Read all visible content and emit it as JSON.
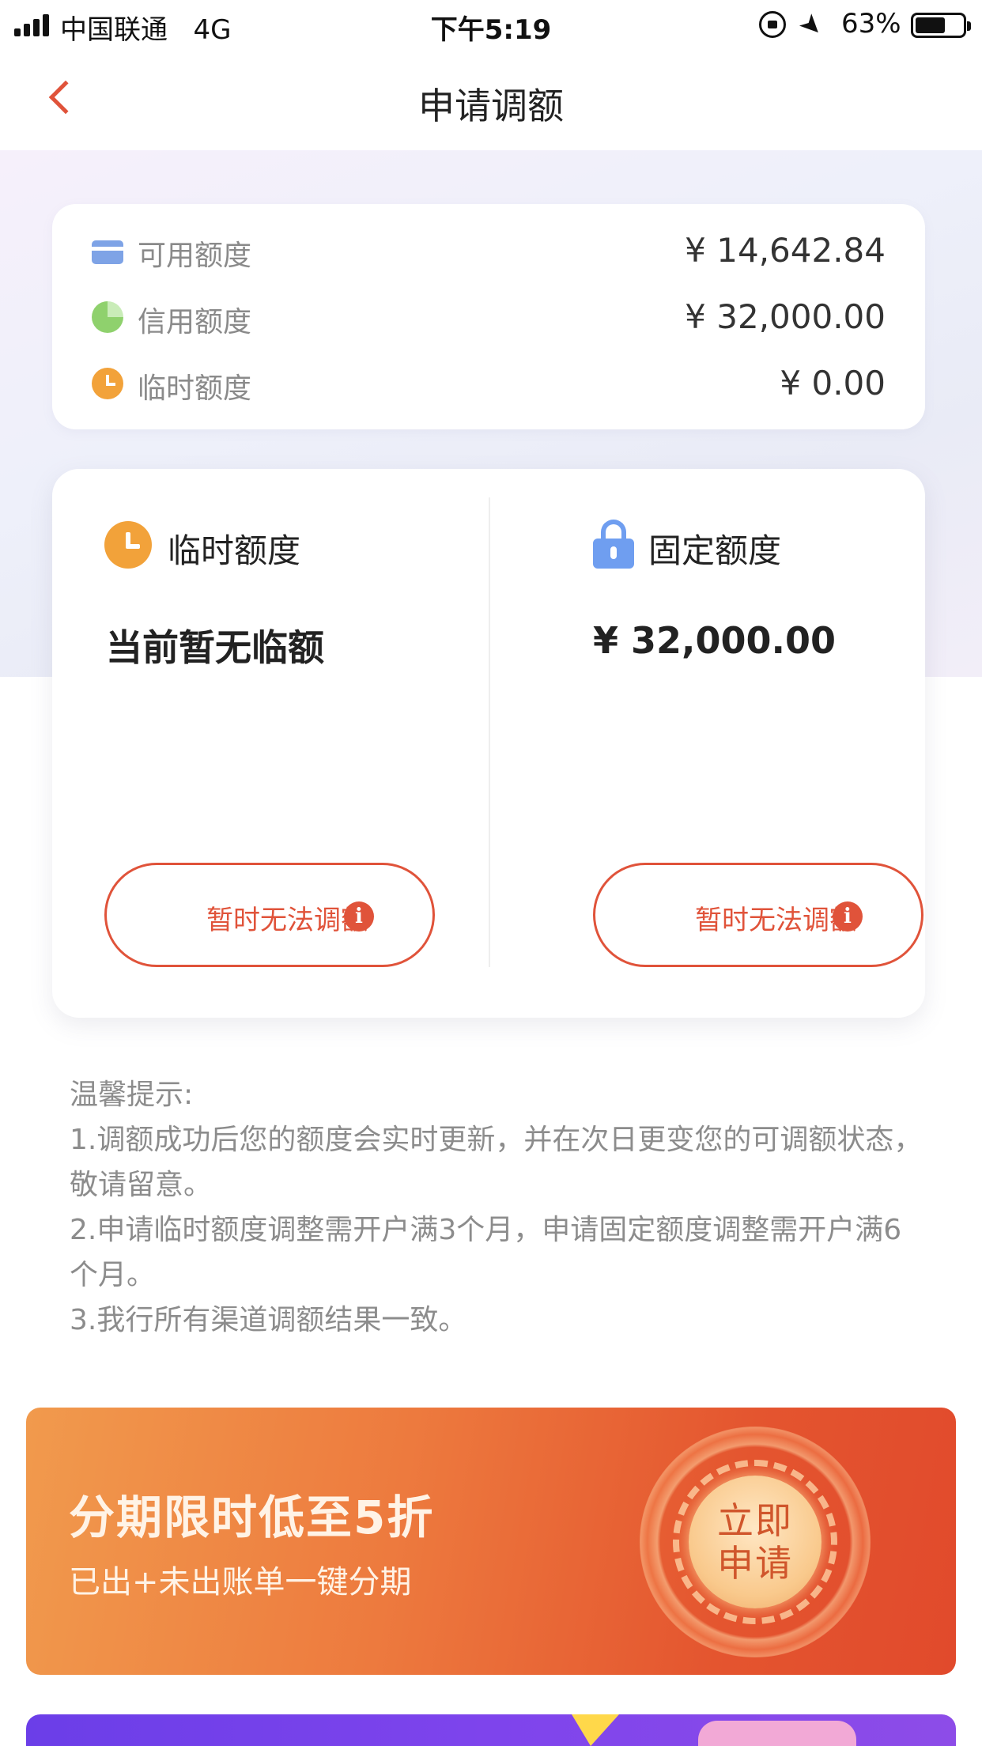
{
  "status_bar": {
    "carrier": "中国联通",
    "network": "4G",
    "time": "下午5:19",
    "battery_percent": "63%",
    "battery_level": 0.63,
    "icons": [
      "signal-icon",
      "rotation-lock-icon",
      "location-icon",
      "battery-icon"
    ]
  },
  "nav": {
    "title": "申请调额",
    "back_icon": "chevron-left-icon"
  },
  "summary": {
    "rows": [
      {
        "icon": "card-icon",
        "label": "可用额度",
        "value": "¥ 14,642.84"
      },
      {
        "icon": "pie-chart-icon",
        "label": "信用额度",
        "value": "¥ 32,000.00"
      },
      {
        "icon": "clock-icon",
        "label": "临时额度",
        "value": "¥ 0.00"
      }
    ]
  },
  "adjust": {
    "temporary": {
      "icon": "clock-icon",
      "title": "临时额度",
      "amount": "当前暂无临额",
      "button_label": "暂时无法调额",
      "button_icon": "info-icon"
    },
    "fixed": {
      "icon": "lock-icon",
      "title": "固定额度",
      "amount": "¥ 32,000.00",
      "button_label": "暂时无法调额",
      "button_icon": "info-icon"
    }
  },
  "tips": {
    "heading": "温馨提示:",
    "items": [
      "1.调额成功后您的额度会实时更新，并在次日更变您的可调额状态，敬请留意。",
      "2.申请临时额度调整需开户满3个月，申请固定额度调整需开户满6个月。",
      "3.我行所有渠道调额结果一致。"
    ]
  },
  "promo": {
    "title": "分期限时低至5折",
    "subtitle": "已出+未出账单一键分期",
    "button_line1": "立即",
    "button_line2": "申请"
  },
  "colors": {
    "accent": "#e0533a",
    "clock_orange": "#f2a23a",
    "lock_blue": "#6f9ef0",
    "card_blue": "#7ea3e6",
    "pie_green": "#8fd16d"
  }
}
